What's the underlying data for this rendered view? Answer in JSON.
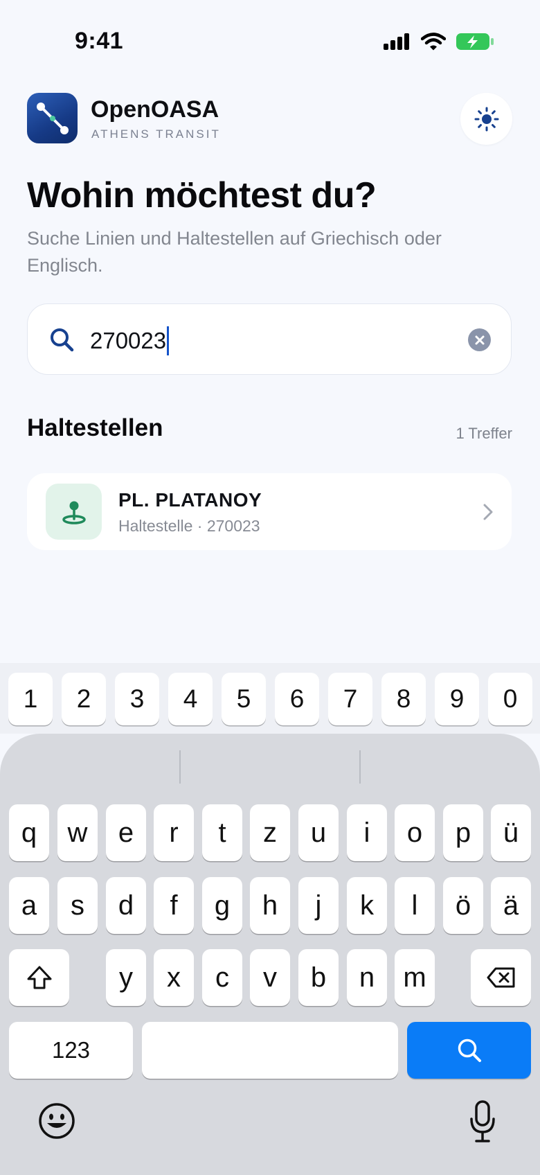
{
  "status_bar": {
    "time": "9:41"
  },
  "header": {
    "app_name": "OpenOASA",
    "app_subtitle": "ATHENS TRANSIT",
    "theme_toggle_icon": "sun-icon"
  },
  "hero": {
    "title": "Wohin möchtest du?",
    "subtitle": "Suche Linien und Haltestellen auf Griechisch oder Englisch."
  },
  "search": {
    "value": "270023",
    "icons": [
      "search-icon",
      "clear-icon"
    ]
  },
  "results": {
    "section_title": "Haltestellen",
    "count_label": "1 Treffer",
    "items": [
      {
        "title": "PL. PLATANOY",
        "subtitle": "Haltestelle · 270023",
        "icon": "stop-pin-icon"
      }
    ]
  },
  "keyboard": {
    "number_row": [
      "1",
      "2",
      "3",
      "4",
      "5",
      "6",
      "7",
      "8",
      "9",
      "0"
    ],
    "row1": [
      "q",
      "w",
      "e",
      "r",
      "t",
      "z",
      "u",
      "i",
      "o",
      "p",
      "ü"
    ],
    "row2": [
      "a",
      "s",
      "d",
      "f",
      "g",
      "h",
      "j",
      "k",
      "l",
      "ö",
      "ä"
    ],
    "row3": [
      "y",
      "x",
      "c",
      "v",
      "b",
      "n",
      "m"
    ],
    "numbers_key": "123",
    "accent_color": "#0a7cf7"
  }
}
